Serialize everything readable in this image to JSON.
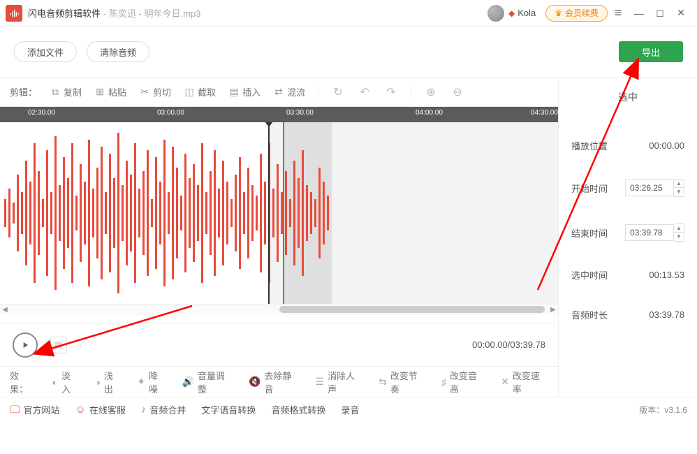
{
  "titlebar": {
    "app_name": "闪电音频剪辑软件",
    "file_name": "- 陈奕迅 - 明年今日.mp3",
    "user_name": "Kola",
    "vip_label": "会员续费"
  },
  "actions": {
    "add_file": "添加文件",
    "clear_audio": "清除音频",
    "export": "导出"
  },
  "toolbar": {
    "label": "剪辑：",
    "copy": "复制",
    "paste": "粘贴",
    "cut": "剪切",
    "crop": "截取",
    "insert": "插入",
    "mix": "混流"
  },
  "ruler": {
    "ticks": [
      {
        "label": "02:30.00",
        "pos": 40
      },
      {
        "label": "03:00.00",
        "pos": 225
      },
      {
        "label": "03:30.00",
        "pos": 410
      },
      {
        "label": "04:00.00",
        "pos": 595
      },
      {
        "label": "04:30.00",
        "pos": 760
      }
    ]
  },
  "playback": {
    "current": "00:00.00",
    "total": "03:39.78"
  },
  "right": {
    "title": "选中",
    "play_pos_label": "播放位置",
    "play_pos": "00:00.00",
    "start_label": "开始时间",
    "start": "03:26.25",
    "end_label": "结束时间",
    "end": "03:39.78",
    "sel_label": "选中时间",
    "sel": "00:13.53",
    "dur_label": "音频时长",
    "dur": "03:39.78"
  },
  "effects": {
    "label": "效果：",
    "fadein": "淡入",
    "fadeout": "浅出",
    "denoise": "降噪",
    "volume": "音量调整",
    "remove_silence": "去除静音",
    "remove_vocal": "消除人声",
    "change_tempo": "改变节奏",
    "change_pitch": "改变音高",
    "change_speed": "改变速率"
  },
  "bottom": {
    "site": "官方网站",
    "support": "在线客服",
    "merge": "音频合并",
    "tts": "文字语音转换",
    "convert": "音频格式转换",
    "record": "录音",
    "version_label": "版本：",
    "version": "v3.1.6"
  }
}
